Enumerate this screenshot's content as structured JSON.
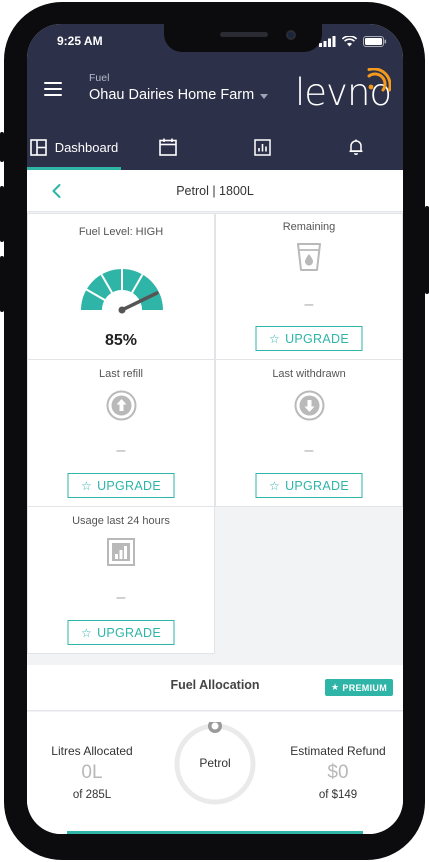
{
  "status_bar": {
    "time": "9:25 AM"
  },
  "header": {
    "farm_label": "Fuel",
    "farm_name": "Ohau Dairies Home Farm",
    "logo_text": "levno"
  },
  "tabs": [
    {
      "label": "Dashboard",
      "icon": "dashboard-icon",
      "active": true
    },
    {
      "label": "",
      "icon": "calendar-icon",
      "active": false
    },
    {
      "label": "",
      "icon": "chart-icon",
      "active": false
    },
    {
      "label": "",
      "icon": "bell-icon",
      "active": false
    }
  ],
  "page": {
    "title": "Petrol | 1800L"
  },
  "cards": {
    "fuel_level": {
      "title": "Fuel Level: HIGH",
      "value": "85%",
      "percent": 85
    },
    "remaining": {
      "title": "Remaining",
      "dash": "–",
      "button": "UPGRADE"
    },
    "last_refill": {
      "title": "Last refill",
      "dash": "–",
      "button": "UPGRADE"
    },
    "last_withdrawn": {
      "title": "Last withdrawn",
      "dash": "–",
      "button": "UPGRADE"
    },
    "usage": {
      "title": "Usage last 24 hours",
      "dash": "–",
      "button": "UPGRADE"
    }
  },
  "fuel_allocation": {
    "title": "Fuel Allocation",
    "badge": "PREMIUM",
    "left": {
      "label": "Litres Allocated",
      "value": "0L",
      "sub": "of 285L"
    },
    "center": {
      "label": "Petrol"
    },
    "right": {
      "label": "Estimated Refund",
      "value": "$0",
      "sub": "of $149"
    }
  },
  "colors": {
    "navy": "#2c3048",
    "teal": "#2fb5a8",
    "gauge": "#2fb5a8",
    "logo_accent": "#f39a1e"
  }
}
